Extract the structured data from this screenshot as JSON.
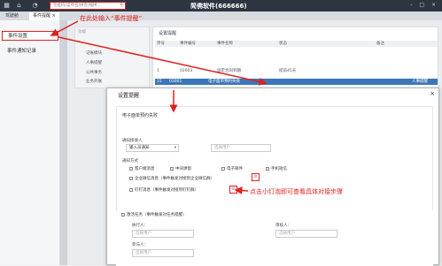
{
  "app": {
    "title": "简佛软件(666666)",
    "search_placeholder": "功能码/菜单名/拼音/缩拼..."
  },
  "topbar": {
    "icons": [
      "grid-icon",
      "home-icon",
      "bell-icon"
    ],
    "right_glyphs": "- □ ×"
  },
  "tabs": [
    {
      "label": "驾驶舱"
    },
    {
      "label": "事件提醒 ×"
    }
  ],
  "sidebar": {
    "items": [
      {
        "label": "事件设置"
      },
      {
        "label": "事件通知记录"
      }
    ]
  },
  "left_pane": {
    "header": "功能",
    "items": [
      "记账模块",
      "人事提醒",
      "公共事务",
      "业务开展"
    ]
  },
  "grid": {
    "title": "设置提醒",
    "columns": [
      "序号",
      "事件编号",
      "事件名称",
      "状态",
      "备注"
    ],
    "rows": [
      {
        "no": "1",
        "code": "02003",
        "name": "固定合同到期",
        "state": "提前45天",
        "note": ""
      },
      {
        "no": "2",
        "code": "",
        "name": "",
        "state": "",
        "note": ""
      },
      {
        "no": "15",
        "code": "03001",
        "name": "电子面单预约失败",
        "state": "",
        "note": "人事提醒"
      }
    ]
  },
  "annotations": {
    "search_hint": "在此处输入“事件提醒”",
    "bulb_hint": "点击小灯泡即可查看具体对接步骤"
  },
  "dialog": {
    "title": "设置提醒",
    "event_name": "电子面单预约失败",
    "notify_who_label": "通知接收人",
    "receiver_select": "输入员通知",
    "receiver_placeholder": "选择用户",
    "notify_method_label": "通知方式",
    "methods": [
      "客户端消息",
      "中间弹窗",
      "电子邮件",
      "手机短信"
    ],
    "wechat_label": "企业微信消息（事件触发对接到企业微信群）",
    "dingtalk_label": "钉钉消息（事件触发对接到钉钉群）",
    "task_label": "激活任务（事件触发对任务提醒）",
    "executor_label": "执行人：",
    "executor_placeholder": "选择用户",
    "reviewer_label": "审核人：",
    "reviewer_placeholder": "选择用户",
    "participant_label": "参与人：",
    "participant_placeholder": "选择用户"
  },
  "colors": {
    "topbar": "#2d3640",
    "highlight": "#3b76b8",
    "annotation": "#e02020"
  }
}
